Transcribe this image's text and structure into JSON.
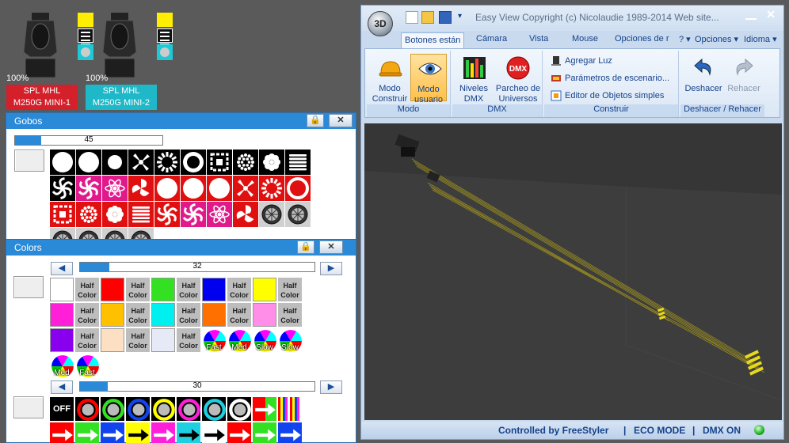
{
  "fixtures": [
    {
      "percent": "100%",
      "name_line1": "SPL MHL",
      "name_line2": "M250G MINI-1",
      "color": "#d4202a"
    },
    {
      "percent": "100%",
      "name_line1": "SPL MHL",
      "name_line2": "M250G MINI-2",
      "color": "#1eb8c8"
    }
  ],
  "gobos_panel": {
    "title": "Gobos",
    "slider_value": 45
  },
  "colors_panel": {
    "title": "Colors",
    "slider_value": 32,
    "half_label_1": "Half",
    "half_label_2": "Color",
    "row1_colors": [
      "#ffffff",
      "#ff0000",
      "#33e022",
      "#0000ee",
      "#ffff00"
    ],
    "row2_colors": [
      "#ff1fd8",
      "#ffc000",
      "#00f0f0",
      "#ff7000",
      "#ff8ee8"
    ],
    "row3_colors": [
      "#8800ee",
      "#fde0c4",
      "#e6eaf6"
    ],
    "wheel_labels": [
      "Fast",
      "Med",
      "Slow",
      "Slow",
      "Med",
      "Fast"
    ]
  },
  "effects": {
    "slider_value": 30,
    "off_label": "OFF",
    "ring_colors": [
      "#ff0000",
      "#33e022",
      "#1144ee",
      "#ffff00",
      "#ff1fd8",
      "#1ecfe0",
      "#ffffff"
    ],
    "arrow_bg_colors": [
      "#ff0000",
      "#33e022",
      "#1144ee",
      "#ffff00",
      "#ff1fd8",
      "#1ecfe0",
      "#ffffff",
      "#ff0000",
      "#33e022",
      "#1144ee",
      "#ffff00",
      "#ff1fd8",
      "#1ecfe0",
      "#ffffff"
    ]
  },
  "window": {
    "logo": "3D",
    "title": "Easy View   Copyright (c) Nicolaudie 1989-2014   Web site...",
    "tabs": [
      "Botones están",
      "Cámara",
      "Vista",
      "Mouse",
      "Opciones de r",
      "?",
      "Opciones",
      "Idioma"
    ],
    "groups": {
      "modo": {
        "label": "Modo",
        "btn1_l1": "Modo",
        "btn1_l2": "Construir",
        "btn2_l1": "Modo",
        "btn2_l2": "usuario"
      },
      "dmx": {
        "label": "DMX",
        "btn1_l1": "Niveles",
        "btn1_l2": "DMX",
        "btn2_l1": "Parcheo de",
        "btn2_l2": "Universos",
        "dmx_icon_text": "DMX"
      },
      "construir": {
        "label": "Construir",
        "items": [
          "Agregar Luz",
          "Parámetros de escenario...",
          "Editor de Objetos simples"
        ]
      },
      "undo": {
        "label": "Deshacer / Rehacer",
        "undo": "Deshacer",
        "redo": "Rehacer"
      }
    },
    "status": {
      "controlled": "Controlled by FreeStyler",
      "eco": "ECO MODE",
      "dmx": "DMX ON"
    }
  }
}
